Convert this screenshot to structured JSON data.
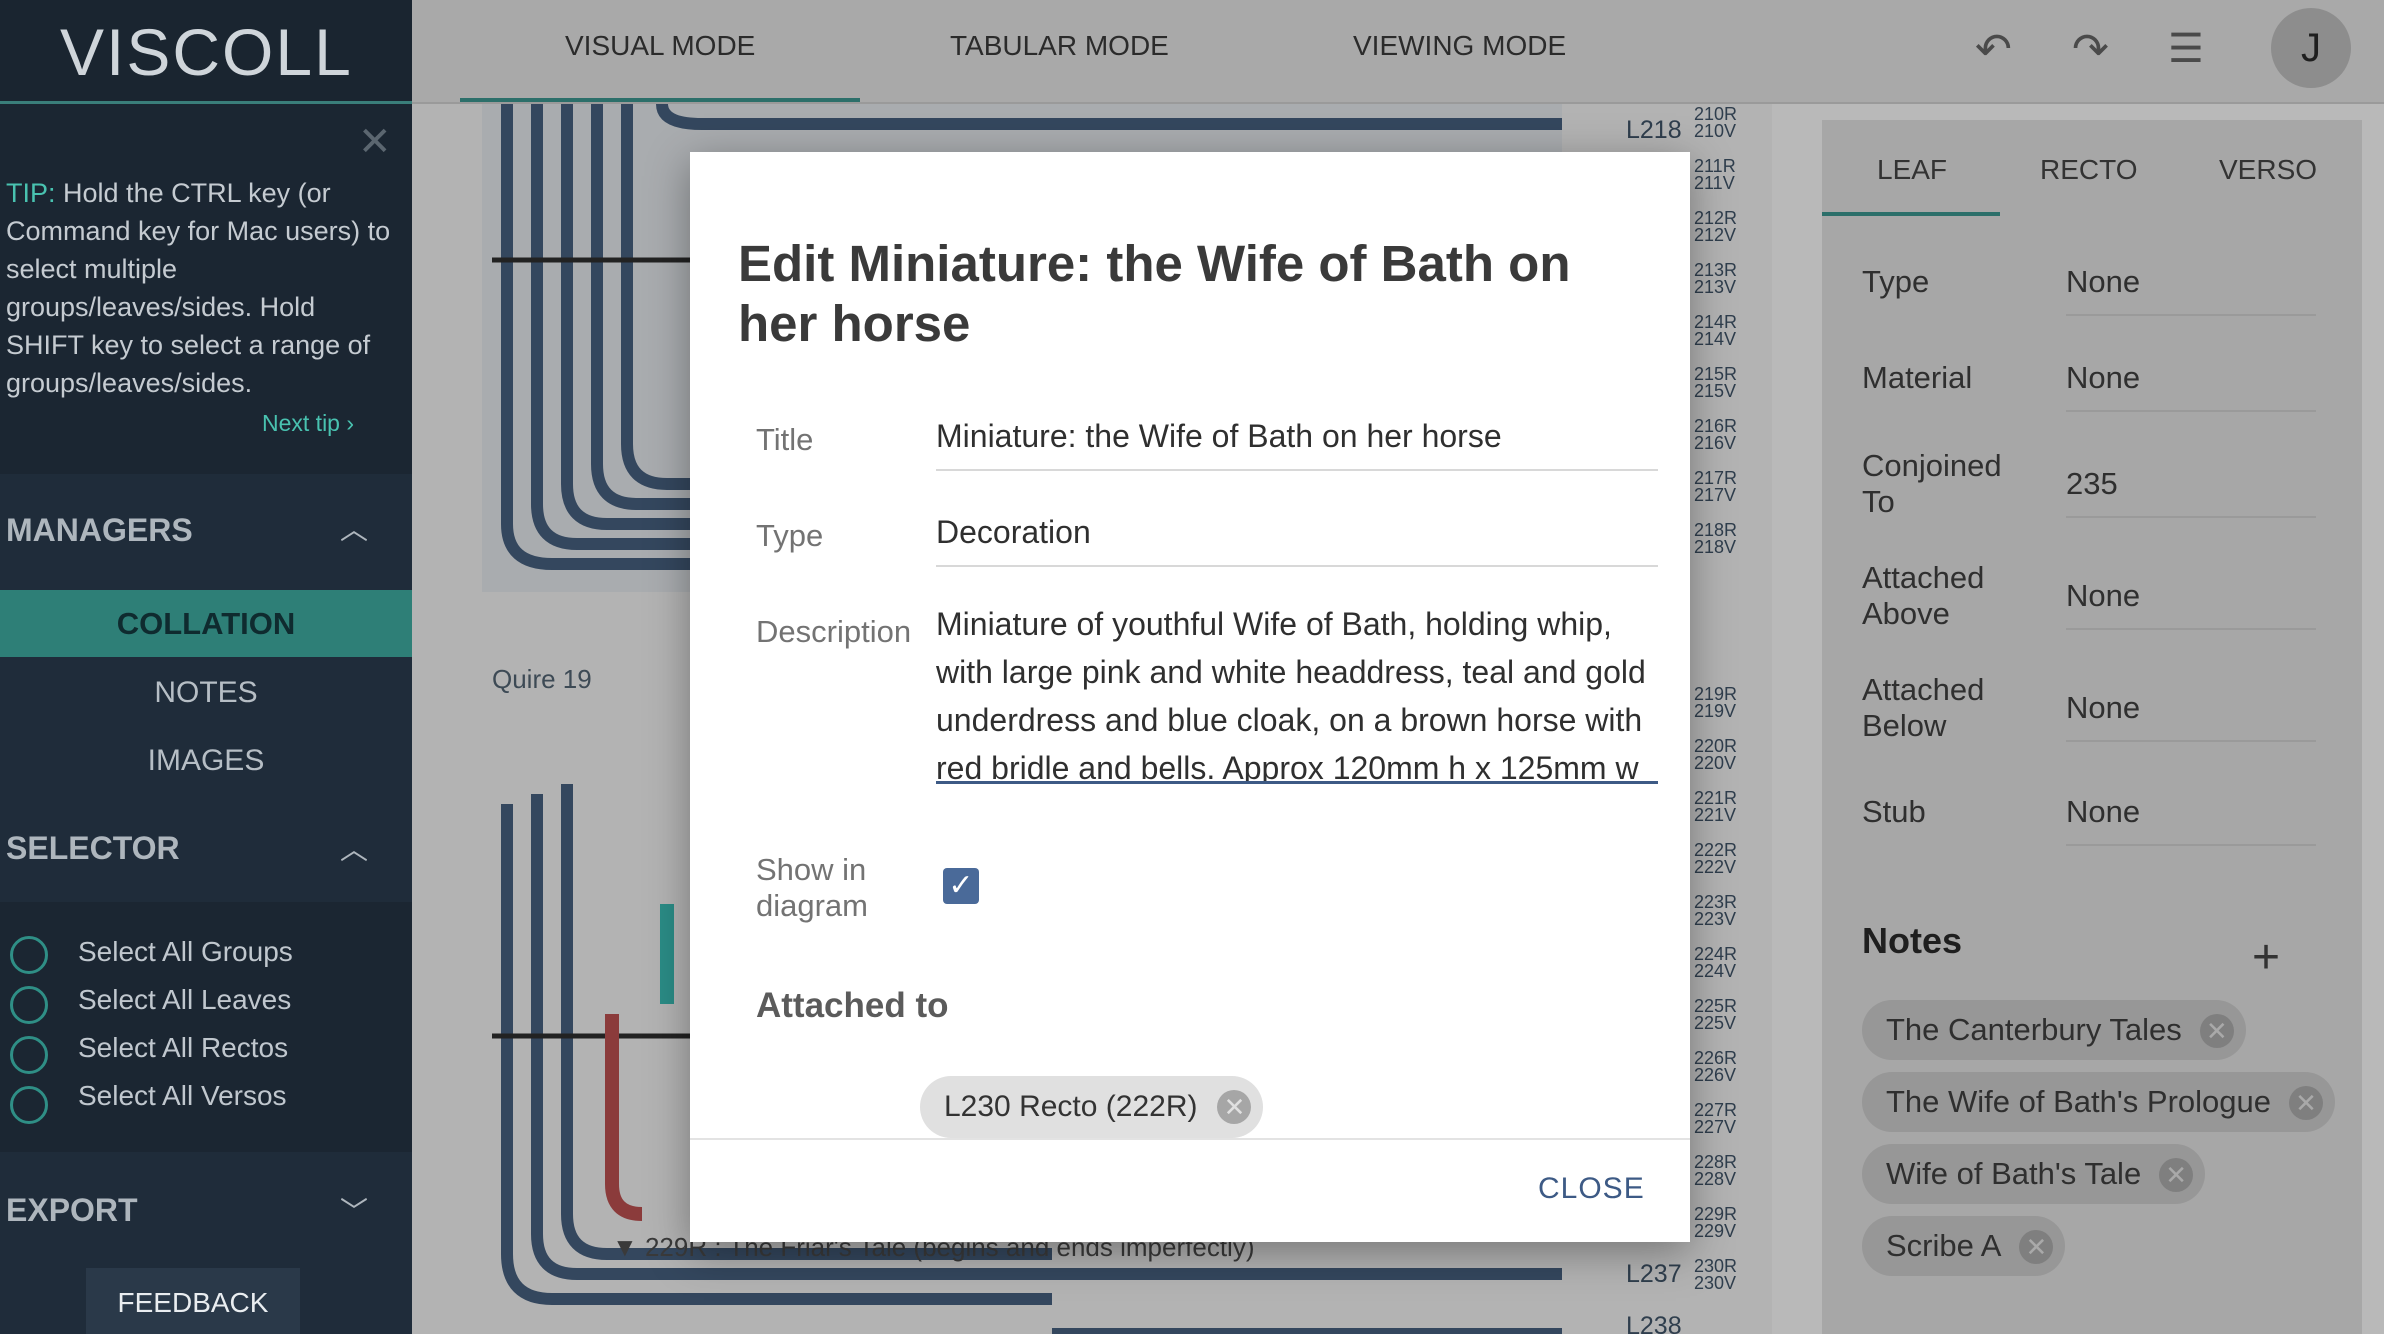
{
  "sidebar": {
    "logo": "VISCOLL",
    "tip": {
      "label": "TIP:",
      "text": "Hold the CTRL key (or Command key for Mac users) to select multiple groups/leaves/sides. Hold SHIFT key to select a range of groups/leaves/sides.",
      "next": "Next tip ›"
    },
    "managers": {
      "title": "MANAGERS",
      "items": [
        "COLLATION",
        "NOTES",
        "IMAGES"
      ]
    },
    "selector": {
      "title": "SELECTOR",
      "items": [
        "Select All Groups",
        "Select All Leaves",
        "Select All Rectos",
        "Select All Versos"
      ]
    },
    "export": {
      "title": "EXPORT"
    },
    "feedback": "FEEDBACK"
  },
  "topbar": {
    "modes": [
      "VISUAL MODE",
      "TABULAR MODE",
      "VIEWING MODE"
    ],
    "avatar": "J"
  },
  "canvas": {
    "quire_label": "Quire 19",
    "leaves": [
      "L218",
      "L237",
      "L238"
    ],
    "folios_top": [
      "210R",
      "210V",
      "211R",
      "211V",
      "212R",
      "212V",
      "213R",
      "213V",
      "214R",
      "214V",
      "215R",
      "215V",
      "216R",
      "216V",
      "217R",
      "217V",
      "218R",
      "218V"
    ],
    "folios_bottom": [
      "219R",
      "219V",
      "220R",
      "220V",
      "221R",
      "221V",
      "222R",
      "222V",
      "223R",
      "223V",
      "224R",
      "224V",
      "225R",
      "225V",
      "226R",
      "226V",
      "227R",
      "227V",
      "228R",
      "228V",
      "229R",
      "229V",
      "230R",
      "230V"
    ],
    "annotation": "▼ 229R : The Friar's Tale (begins and ends imperfectly)"
  },
  "right_panel": {
    "tabs": [
      "LEAF",
      "RECTO",
      "VERSO"
    ],
    "props": [
      {
        "label": "Type",
        "value": "None"
      },
      {
        "label": "Material",
        "value": "None"
      },
      {
        "label": "Conjoined To",
        "value": "235"
      },
      {
        "label": "Attached Above",
        "value": "None"
      },
      {
        "label": "Attached Below",
        "value": "None"
      },
      {
        "label": "Stub",
        "value": "None"
      }
    ],
    "notes_title": "Notes",
    "notes_add": "+",
    "notes": [
      "The Canterbury Tales",
      "The Wife of Bath's Prologue",
      "Wife of Bath's Tale",
      "Scribe A"
    ]
  },
  "modal": {
    "title": "Edit Miniature: the Wife of Bath on her horse",
    "fields": {
      "title_label": "Title",
      "title_value": "Miniature: the Wife of Bath on her horse",
      "type_label": "Type",
      "type_value": "Decoration",
      "description_label": "Description",
      "description_value": "Miniature of youthful Wife of Bath, holding whip, with large pink and white headdress, teal and gold underdress and blue cloak, on a brown horse with red bridle and bells. Approx 120mm h x 125mm w",
      "show_label": "Show in diagram",
      "show_checked": true
    },
    "attached_title": "Attached to",
    "attached_chip": "L230 Recto (222R)",
    "close": "CLOSE"
  },
  "colors": {
    "accent": "#2e7f77",
    "modal_link": "#3d5a85",
    "sidebar_bg": "#1f2c3a"
  }
}
